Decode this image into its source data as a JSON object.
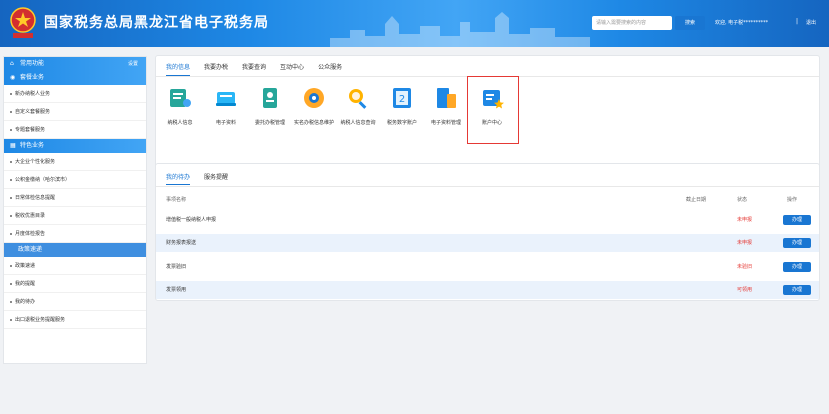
{
  "header": {
    "site_title": "国家税务总局黑龙江省电子税务局",
    "search_placeholder": "请输入需要搜索的内容",
    "search_button": "搜索",
    "welcome": "欢迎, 电子税**********",
    "separator": "|",
    "logout": "退出",
    "brand_color": "#1e88e5"
  },
  "sidebar": {
    "common_title": "常用功能",
    "common_setting": "设置",
    "package_title": "套餐业务",
    "package_items": [
      "新办纳税人业务",
      "自定义套餐服务",
      "专题套餐服务"
    ],
    "special_title": "特色业务",
    "special_items": [
      "大企业个性化服务",
      "公积金缴纳（哈尔滨市）",
      "日常体检信息提醒",
      "税收优惠目录",
      "月度体检报告"
    ],
    "policy_title": "政策速递",
    "policy_items": [
      "政策速递",
      "我的提醒",
      "我的待办",
      "出口退税业务提醒服务"
    ]
  },
  "info_panel": {
    "tabs": [
      "我的信息",
      "我要办税",
      "我要查询",
      "互动中心",
      "公众服务"
    ],
    "active_tab": 0,
    "apps": [
      {
        "label": "纳税人信息",
        "icon": "taxpayer-info-icon"
      },
      {
        "label": "电子资料",
        "icon": "electronic-data-icon"
      },
      {
        "label": "委托办税管理",
        "icon": "delegate-tax-icon"
      },
      {
        "label": "实名办税信息维护",
        "icon": "realname-maintain-icon"
      },
      {
        "label": "纳税人信息查询",
        "icon": "taxpayer-query-icon"
      },
      {
        "label": "税务数字账户",
        "icon": "digital-account-icon"
      },
      {
        "label": "电子资料管理",
        "icon": "data-management-icon"
      },
      {
        "label": "账户中心",
        "icon": "account-center-icon"
      }
    ]
  },
  "todo_panel": {
    "tabs": [
      "我的待办",
      "服务提醒"
    ],
    "active_tab": 0,
    "columns": {
      "name": "事项名称",
      "date": "截止日期",
      "status": "状态",
      "op": "操作"
    },
    "rows": [
      {
        "name": "增值税一般纳税人申报",
        "date": "",
        "status": "未申报",
        "status_color": "#e53935",
        "op": "办理"
      },
      {
        "name": "财务报表报送",
        "date": "",
        "status": "未申报",
        "status_color": "#e53935",
        "op": "办理"
      },
      {
        "name": "发票验旧",
        "date": "",
        "status": "未验旧",
        "status_color": "#e53935",
        "op": "办理"
      },
      {
        "name": "发票领用",
        "date": "",
        "status": "可领用",
        "status_color": "#e53935",
        "op": "办理"
      }
    ]
  }
}
